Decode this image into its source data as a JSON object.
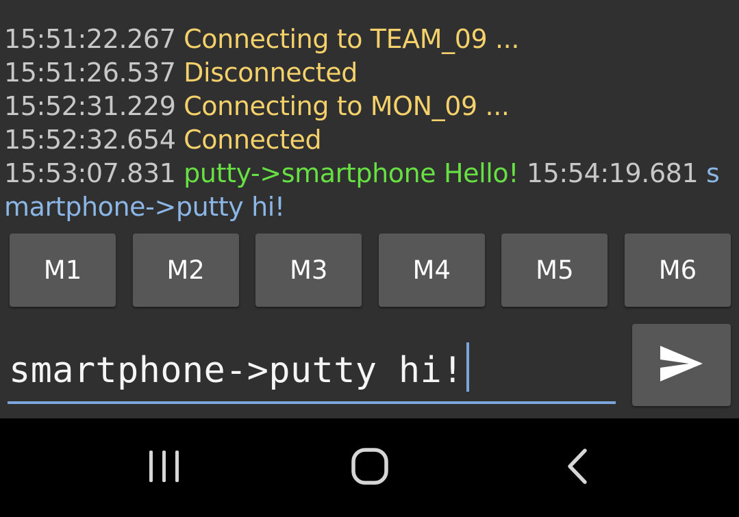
{
  "log": [
    {
      "time": "15:51:22.267",
      "text": "Connecting to TEAM_09 ...",
      "kind": "info"
    },
    {
      "time": "15:51:26.537",
      "text": "Disconnected",
      "kind": "info"
    },
    {
      "time": "15:52:31.229",
      "text": "Connecting to MON_09 ...",
      "kind": "info"
    },
    {
      "time": "15:52:32.654",
      "text": "Connected",
      "kind": "info"
    },
    {
      "time": "15:53:07.831",
      "text": "putty->smartphone Hello!",
      "kind": "rx"
    },
    {
      "time": "15:54:19.681",
      "text": "smartphone->putty hi!",
      "kind": "tx"
    }
  ],
  "macros": [
    "M1",
    "M2",
    "M3",
    "M4",
    "M5",
    "M6"
  ],
  "input": {
    "value": "smartphone->putty hi!"
  },
  "icons": {
    "send": "send-icon",
    "recents": "recent-apps-icon",
    "home": "home-icon",
    "back": "back-icon"
  },
  "colors": {
    "background": "#303030",
    "timestamp": "#c8c8c8",
    "info": "#f4d16a",
    "received": "#66e043",
    "sent": "#8bb6e6",
    "accent": "#7aa6dc",
    "button": "#575757"
  }
}
